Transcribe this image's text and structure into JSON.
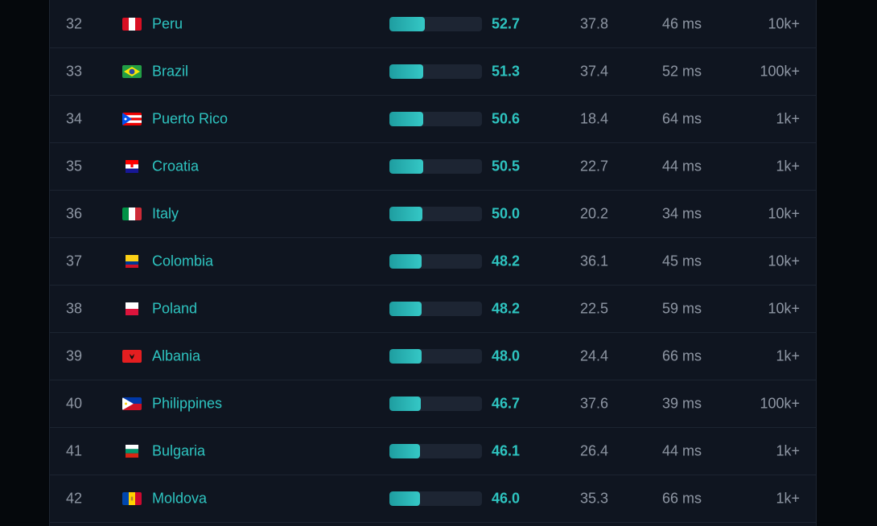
{
  "rows": [
    {
      "rank": "32",
      "country": "Peru",
      "flag": "peru-flag-icon",
      "score": "52.7",
      "fill": 0.3795,
      "speed": "37.8",
      "ping": "46 ms",
      "users": "10k+"
    },
    {
      "rank": "33",
      "country": "Brazil",
      "flag": "brazil-flag-icon",
      "score": "51.3",
      "fill": 0.3695,
      "speed": "37.4",
      "ping": "52 ms",
      "users": "100k+"
    },
    {
      "rank": "34",
      "country": "Puerto Rico",
      "flag": "puerto-rico-flag-icon",
      "score": "50.6",
      "fill": 0.3644,
      "speed": "18.4",
      "ping": "64 ms",
      "users": "1k+"
    },
    {
      "rank": "35",
      "country": "Croatia",
      "flag": "croatia-flag-icon",
      "score": "50.5",
      "fill": 0.3637,
      "speed": "22.7",
      "ping": "44 ms",
      "users": "1k+"
    },
    {
      "rank": "36",
      "country": "Italy",
      "flag": "italy-flag-icon",
      "score": "50.0",
      "fill": 0.3601,
      "speed": "20.2",
      "ping": "34 ms",
      "users": "10k+"
    },
    {
      "rank": "37",
      "country": "Colombia",
      "flag": "colombia-flag-icon",
      "score": "48.2",
      "fill": 0.3471,
      "speed": "36.1",
      "ping": "45 ms",
      "users": "10k+"
    },
    {
      "rank": "38",
      "country": "Poland",
      "flag": "poland-flag-icon",
      "score": "48.2",
      "fill": 0.3471,
      "speed": "22.5",
      "ping": "59 ms",
      "users": "10k+"
    },
    {
      "rank": "39",
      "country": "Albania",
      "flag": "albania-flag-icon",
      "score": "48.0",
      "fill": 0.3457,
      "speed": "24.4",
      "ping": "66 ms",
      "users": "1k+"
    },
    {
      "rank": "40",
      "country": "Philippines",
      "flag": "philippines-flag-icon",
      "score": "46.7",
      "fill": 0.3363,
      "speed": "37.6",
      "ping": "39 ms",
      "users": "100k+"
    },
    {
      "rank": "41",
      "country": "Bulgaria",
      "flag": "bulgaria-flag-icon",
      "score": "46.1",
      "fill": 0.332,
      "speed": "26.4",
      "ping": "44 ms",
      "users": "1k+"
    },
    {
      "rank": "42",
      "country": "Moldova",
      "flag": "moldova-flag-icon",
      "score": "46.0",
      "fill": 0.3313,
      "speed": "35.3",
      "ping": "66 ms",
      "users": "1k+"
    }
  ]
}
